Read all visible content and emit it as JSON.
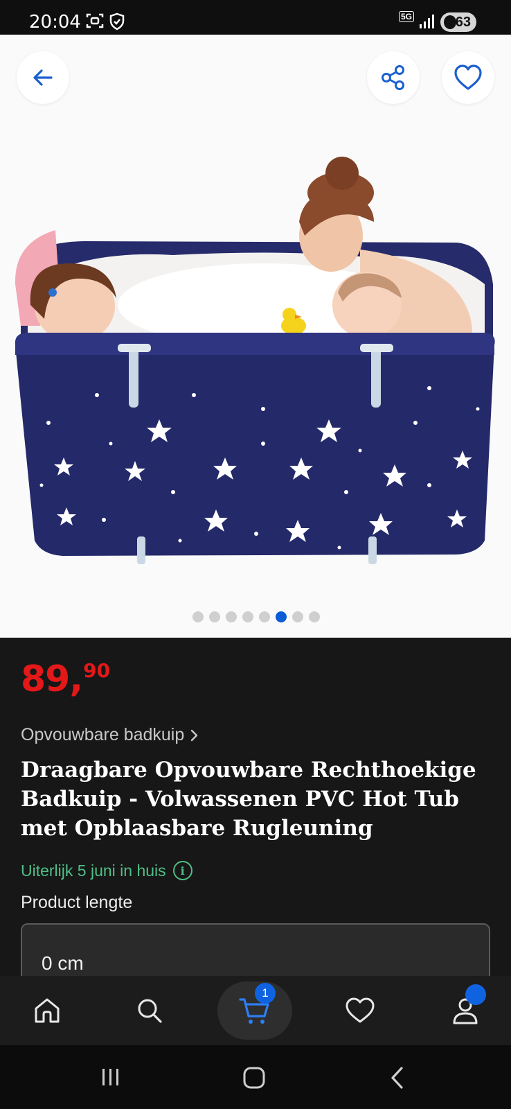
{
  "status_bar": {
    "time": "20:04",
    "network": "5G",
    "battery": "63",
    "icons": [
      "screenshot-icon",
      "shield-icon",
      "signal-icon",
      "battery-icon"
    ]
  },
  "gallery": {
    "image_description_icon": "product-photo",
    "dots_total": 8,
    "active_dot": 6
  },
  "product": {
    "price_int": "89",
    "price_comma": ",",
    "price_cents": "90",
    "breadcrumb": "Opvouwbare badkuip",
    "title": "Draagbare Opvouwbare Rechthoekige Badkuip - Volwassenen PVC Hot Tub met Opblaasbare Rugleuning",
    "delivery": "Uiterlijk 5 juni in huis",
    "field_label": "Product lengte",
    "field_value": "0 cm"
  },
  "bottom_nav": {
    "items": [
      "home-icon",
      "search-icon",
      "cart-icon",
      "heart-icon",
      "account-icon"
    ],
    "cart_count": "1"
  },
  "colors": {
    "price": "#e31818",
    "delivery": "#4fbf86",
    "accent": "#0a5bd8"
  }
}
